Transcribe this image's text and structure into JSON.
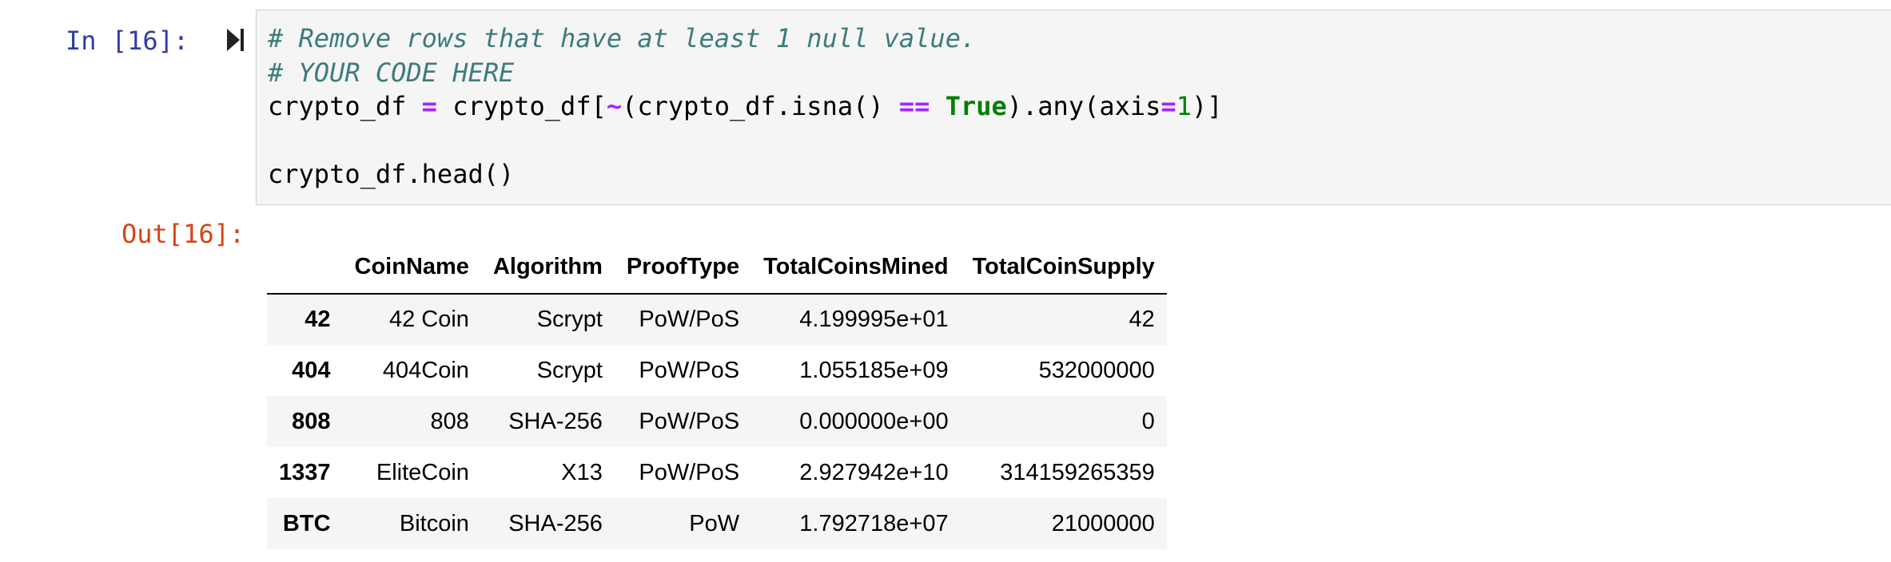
{
  "cell_in": {
    "prompt": "In [16]:",
    "code": {
      "line1": "# Remove rows that have at least 1 null value.",
      "line2": "# YOUR CODE HERE",
      "line3": {
        "t1": "crypto_df ",
        "op1": "=",
        "t2": " crypto_df[",
        "op2": "~",
        "t3": "(crypto_df.isna() ",
        "op3": "==",
        "t4": " ",
        "kw": "True",
        "t5": ").any(axis",
        "op4": "=",
        "num": "1",
        "t6": ")]"
      },
      "line5": "crypto_df.head()"
    },
    "run_icon": "run-cell-icon"
  },
  "cell_out": {
    "prompt": "Out[16]:",
    "table": {
      "index_header": "",
      "columns": [
        "CoinName",
        "Algorithm",
        "ProofType",
        "TotalCoinsMined",
        "TotalCoinSupply"
      ],
      "rows": [
        {
          "index": "42",
          "values": [
            "42 Coin",
            "Scrypt",
            "PoW/PoS",
            "4.199995e+01",
            "42"
          ]
        },
        {
          "index": "404",
          "values": [
            "404Coin",
            "Scrypt",
            "PoW/PoS",
            "1.055185e+09",
            "532000000"
          ]
        },
        {
          "index": "808",
          "values": [
            "808",
            "SHA-256",
            "PoW/PoS",
            "0.000000e+00",
            "0"
          ]
        },
        {
          "index": "1337",
          "values": [
            "EliteCoin",
            "X13",
            "PoW/PoS",
            "2.927942e+10",
            "314159265359"
          ]
        },
        {
          "index": "BTC",
          "values": [
            "Bitcoin",
            "SHA-256",
            "PoW",
            "1.792718e+07",
            "21000000"
          ]
        }
      ]
    }
  },
  "colors": {
    "prompt_in": "#303f9f",
    "prompt_out": "#d84315",
    "comment": "#3d7b7b",
    "operator": "#aa22ff",
    "keyword": "#008000",
    "cell_bg": "#f5f5f5",
    "cell_border": "#cfcfcf"
  }
}
